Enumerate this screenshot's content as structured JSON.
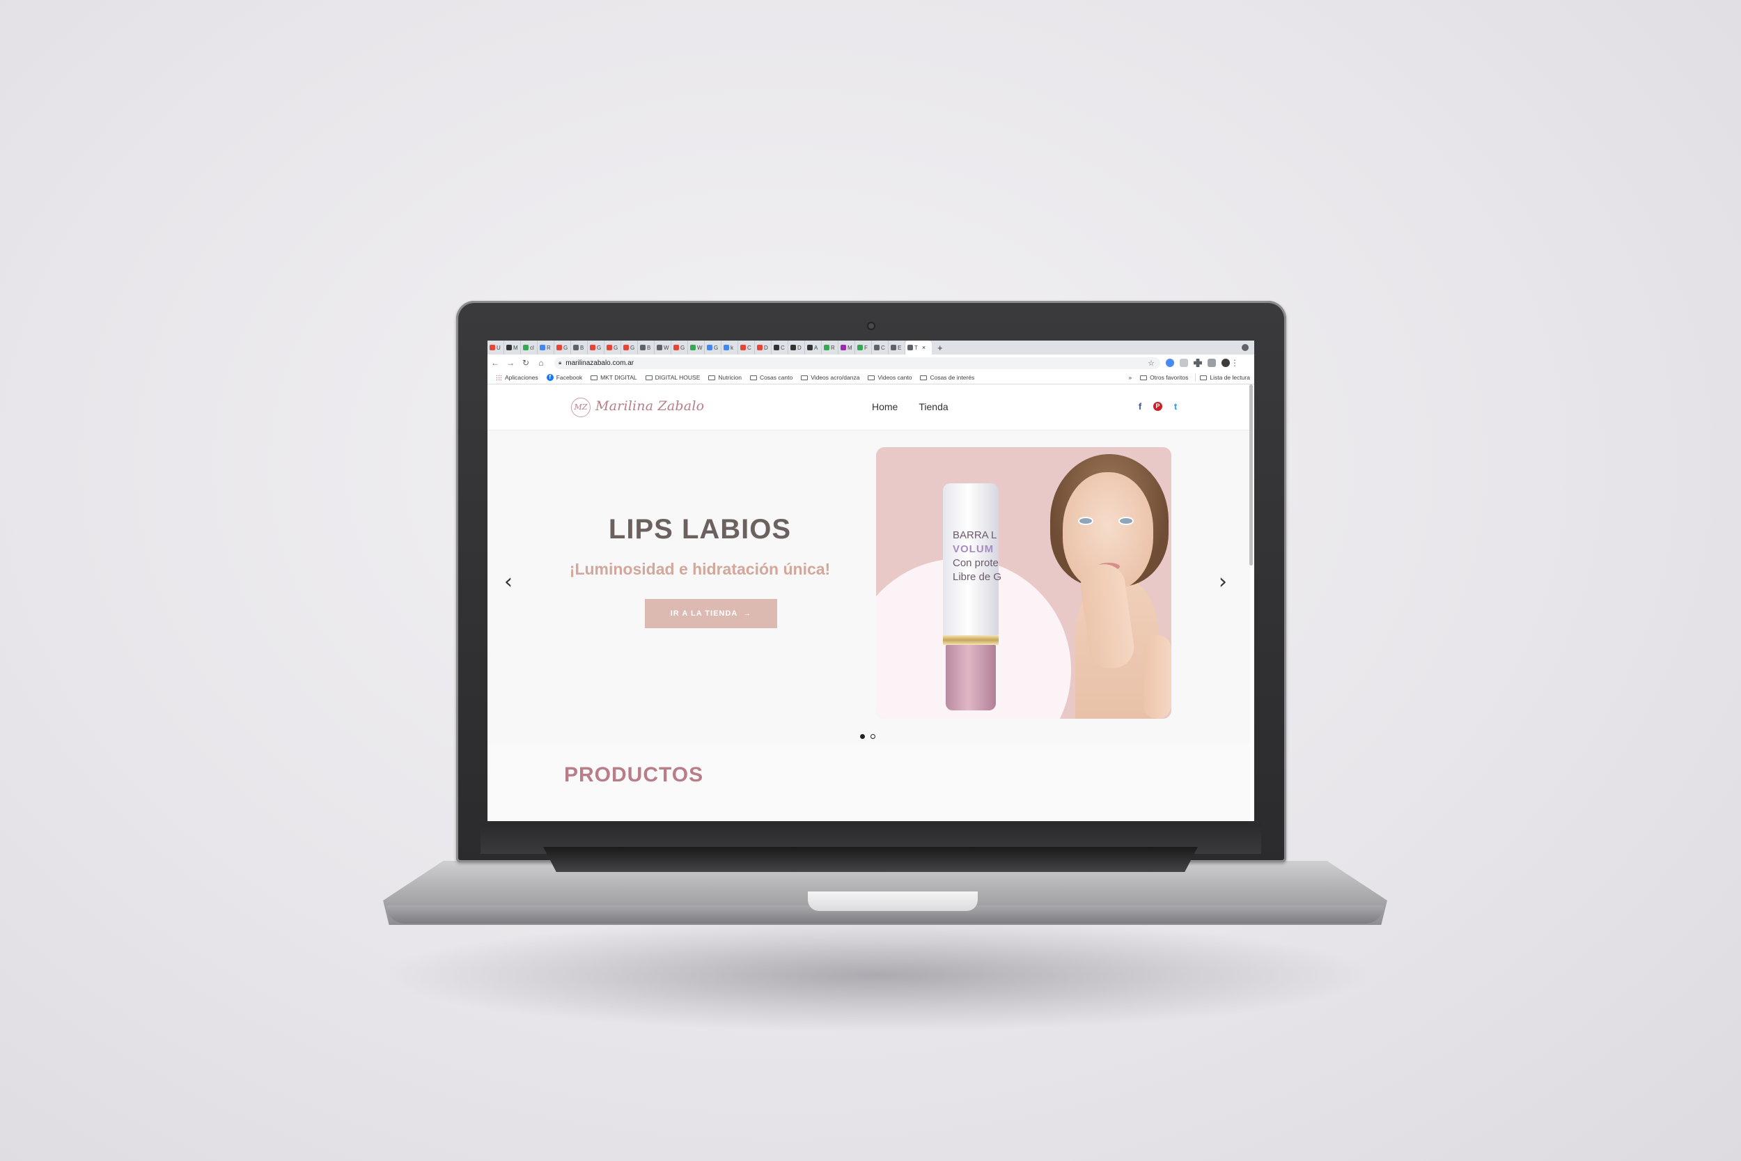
{
  "browser": {
    "tabs": [
      "U",
      "M",
      "cl",
      "R",
      "G",
      "B",
      "G",
      "G",
      "G",
      "B",
      "W",
      "G",
      "W",
      "G",
      "k",
      "C",
      "D",
      "C",
      "D",
      "A",
      "R",
      "M",
      "F",
      "C",
      "E",
      "T"
    ],
    "active_tab_close": "×",
    "new_tab": "+",
    "url": "marilinazabalo.com.ar",
    "nav_back": "←",
    "nav_forward": "→",
    "nav_reload": "↻",
    "nav_home": "⌂",
    "star": "☆",
    "bookmarks": [
      "Aplicaciones",
      "Facebook",
      "MKT DIGITAL",
      "DIGITAL HOUSE",
      "Nutricion",
      "Cosas canto",
      "Videos acro/danza",
      "Videos canto",
      "Cosas de interés"
    ],
    "overflow": "»",
    "other_favorites": "Otros favoritos",
    "reading_list": "Lista de lectura"
  },
  "site": {
    "logo_initials": "MZ",
    "logo_text": "Marilina Zabalo",
    "menu": [
      "Home",
      "Tienda"
    ],
    "social": {
      "facebook": "f",
      "pinterest": "P",
      "twitter": "t"
    },
    "hero": {
      "title": "LIPS LABIOS",
      "subtitle": "¡Luminosidad e hidratación única!",
      "button_label": "IR A LA TIENDA",
      "button_arrow": "→",
      "prev_arrow": "‹",
      "next_arrow": "›",
      "image_text_line1": "BARRA L",
      "image_text_line2": "VOLUM",
      "image_text_line3": "Con prote",
      "image_text_line4": "Libre de G",
      "slides_total": 2,
      "slide_active": 1
    },
    "products_title": "PRODUCTOS"
  },
  "colors": {
    "accent": "#b87d87",
    "button": "#dcbab2",
    "subtitle": "#d2a79c",
    "title": "#6b6260"
  }
}
